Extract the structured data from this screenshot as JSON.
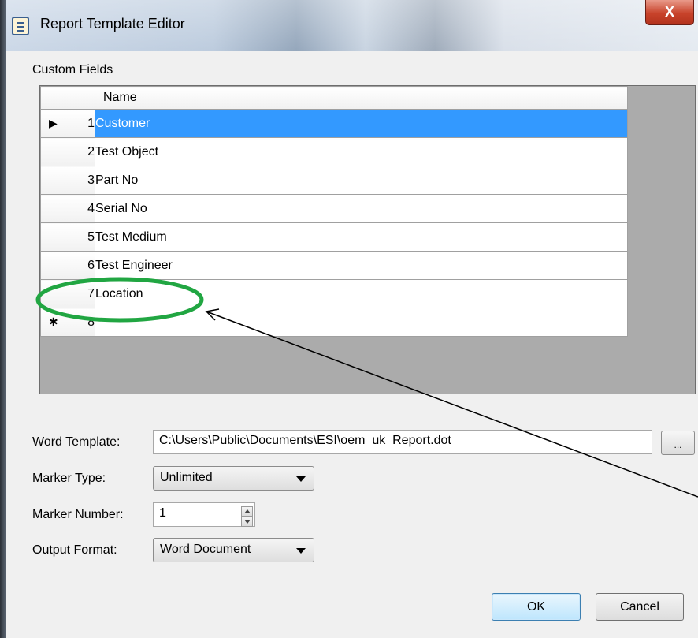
{
  "window": {
    "title": "Report Template Editor",
    "close_label": "X"
  },
  "custom_fields": {
    "label": "Custom Fields",
    "column_header": "Name",
    "rows": [
      {
        "num": "1",
        "name": "Customer",
        "selected": true,
        "indicator": "▶"
      },
      {
        "num": "2",
        "name": "Test Object"
      },
      {
        "num": "3",
        "name": "Part No"
      },
      {
        "num": "4",
        "name": "Serial No"
      },
      {
        "num": "5",
        "name": "Test Medium"
      },
      {
        "num": "6",
        "name": "Test Engineer"
      },
      {
        "num": "7",
        "name": "Location"
      },
      {
        "num": "8",
        "name": "",
        "indicator": "✱"
      }
    ]
  },
  "word_template": {
    "label": "Word Template:",
    "value": "C:\\Users\\Public\\Documents\\ESI\\oem_uk_Report.dot",
    "browse_label": "..."
  },
  "marker_type": {
    "label": "Marker Type:",
    "value": "Unlimited"
  },
  "marker_number": {
    "label": "Marker Number:",
    "value": "1"
  },
  "output_format": {
    "label": "Output Format:",
    "value": "Word Document"
  },
  "buttons": {
    "ok": "OK",
    "cancel": "Cancel"
  },
  "colors": {
    "selection": "#3399ff",
    "annotation_ellipse": "#21a642",
    "annotation_arrow": "#000000"
  }
}
